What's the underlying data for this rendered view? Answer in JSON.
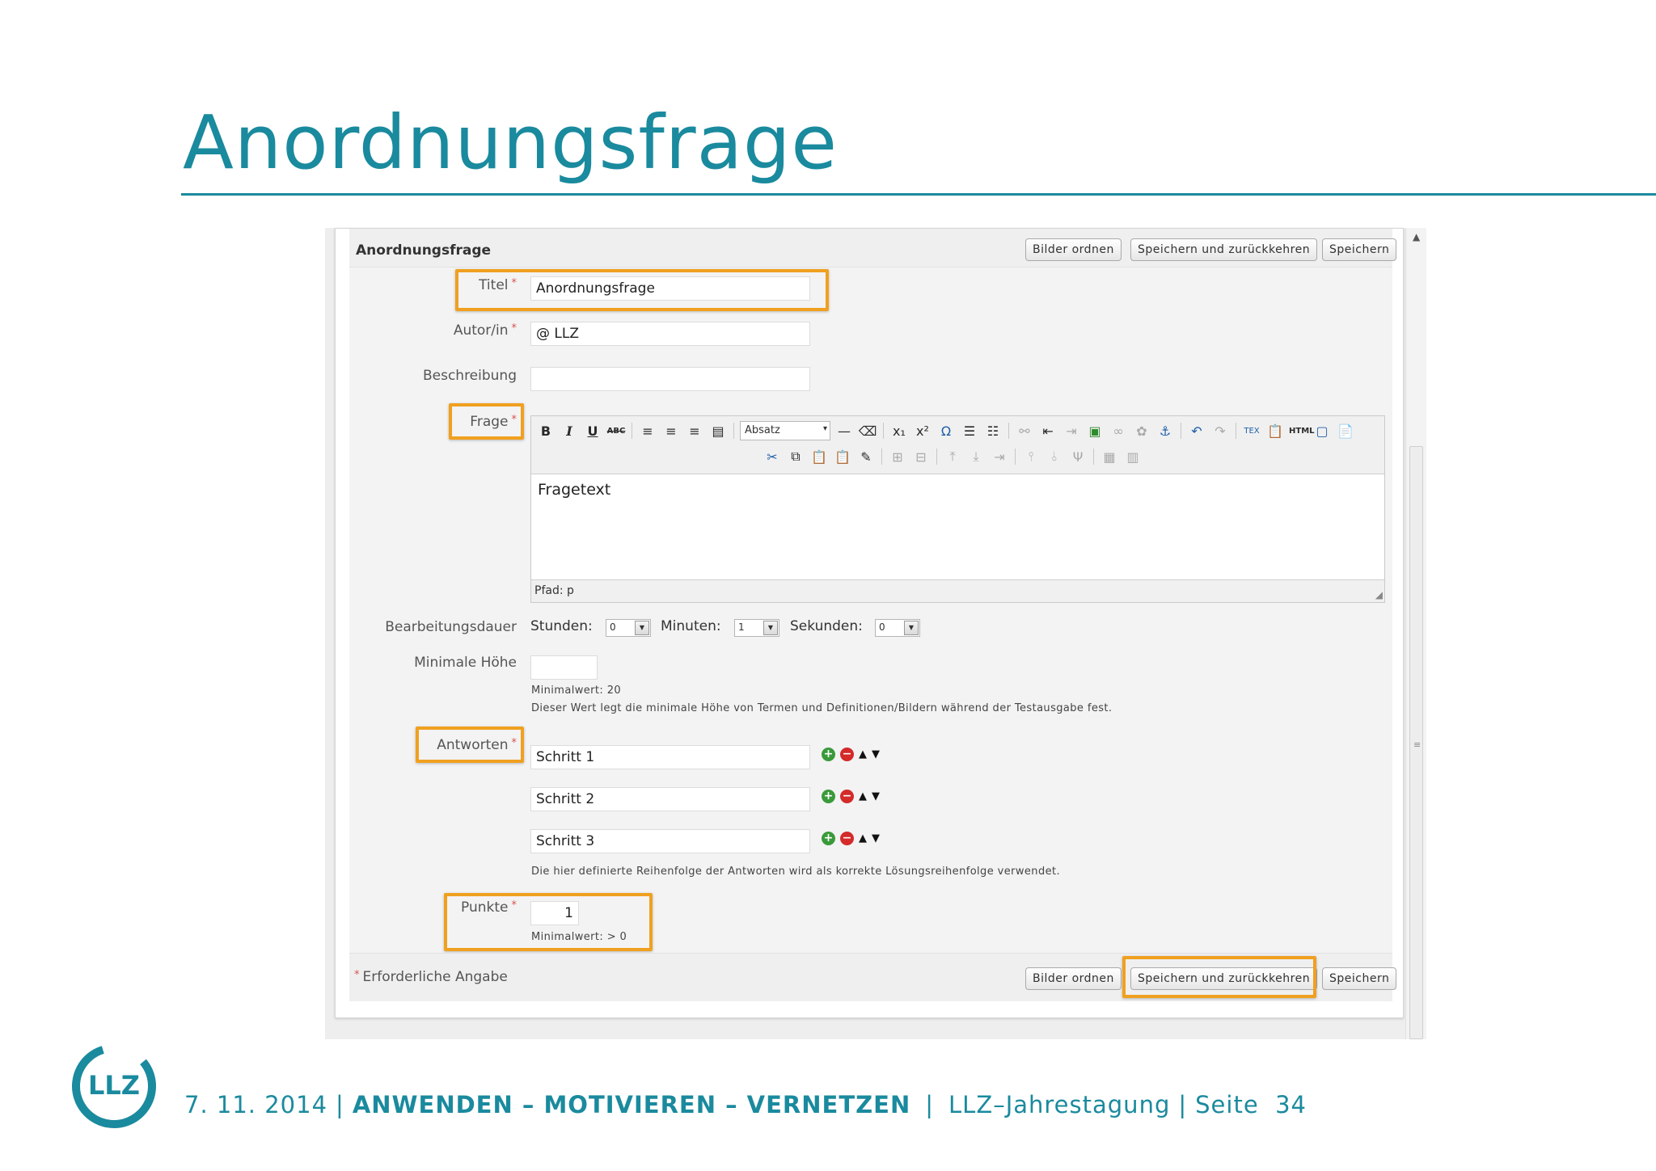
{
  "slide": {
    "title": "Anordnungsfrage"
  },
  "form": {
    "heading": "Anordnungsfrage",
    "required_mark": "*",
    "buttons": {
      "bilder_ordnen": "Bilder ordnen",
      "speichern_zurueck": "Speichern und zurückkehren",
      "speichern": "Speichern"
    },
    "fields": {
      "titel": {
        "label": "Titel",
        "value": "Anordnungsfrage"
      },
      "autor": {
        "label": "Autor/in",
        "value": "@ LLZ"
      },
      "beschreibung": {
        "label": "Beschreibung",
        "value": ""
      },
      "frage": {
        "label": "Frage"
      }
    },
    "editor": {
      "format_select": "Absatz",
      "content": "Fragetext",
      "status_path": "Pfad: p",
      "toolbar_glyphs": {
        "bold": "B",
        "italic": "I",
        "underline": "U",
        "strike": "ABC",
        "omega": "Ω",
        "tex": "TEX",
        "html": "HTML",
        "sub": "x₁",
        "sup": "x²"
      }
    },
    "duration": {
      "label": "Bearbeitungsdauer",
      "stunden_label": "Stunden:",
      "stunden_value": "0",
      "minuten_label": "Minuten:",
      "minuten_value": "1",
      "sekunden_label": "Sekunden:",
      "sekunden_value": "0"
    },
    "min_height": {
      "label": "Minimale Höhe",
      "value": "",
      "hint_min": "Minimalwert: 20",
      "hint_desc": "Dieser Wert legt die minimale Höhe von Termen und Definitionen/Bildern während der Testausgabe fest."
    },
    "answers": {
      "label": "Antworten",
      "items": [
        "Schritt 1",
        "Schritt 2",
        "Schritt 3"
      ],
      "hint": "Die hier definierte Reihenfolge der Antworten wird als korrekte Lösungsreihenfolge verwendet."
    },
    "points": {
      "label": "Punkte",
      "value": "1",
      "hint": "Minimalwert: > 0"
    },
    "required_note": "Erforderliche Angabe"
  },
  "footer": {
    "date": "7. 11. 2014",
    "motto": "ANWENDEN – MOTIVIEREN – VERNETZEN",
    "event": "LLZ–Jahrestagung",
    "page_label": "Seite",
    "page_number": "34",
    "logo_text": "LLZ"
  },
  "colors": {
    "accent": "#1a8a9e",
    "highlight": "#f0a020",
    "required": "#d9534f"
  }
}
